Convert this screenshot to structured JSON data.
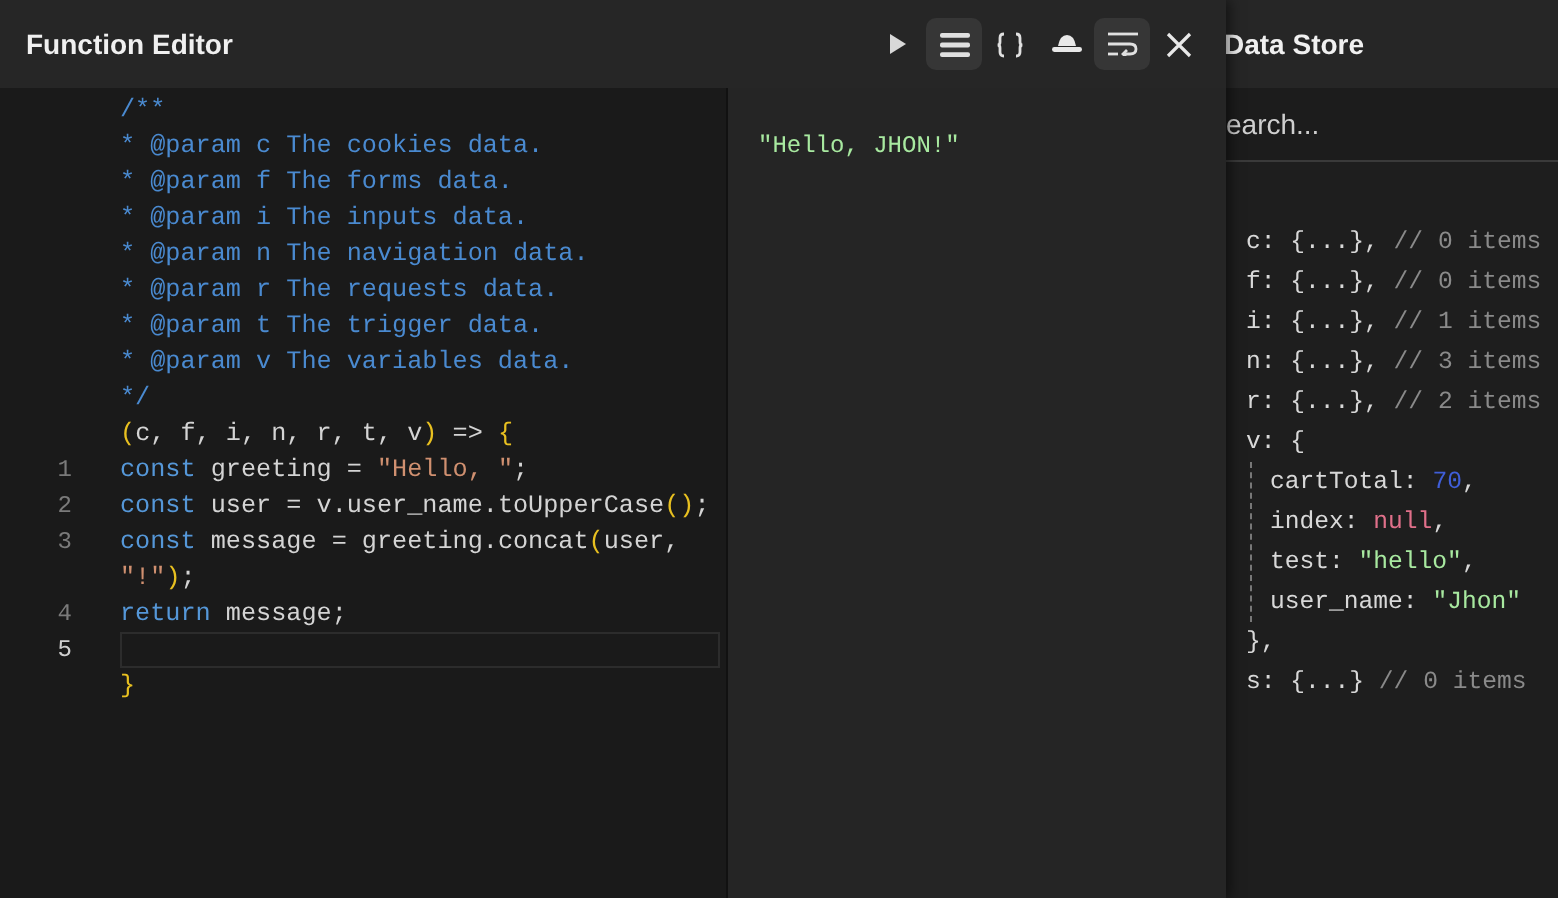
{
  "editor": {
    "title": "Function Editor",
    "toolbar": [
      {
        "kind": "run",
        "selected": false
      },
      {
        "kind": "list",
        "selected": true
      },
      {
        "kind": "braces",
        "selected": false
      },
      {
        "kind": "hat",
        "selected": false
      },
      {
        "kind": "wrap",
        "selected": true
      },
      {
        "kind": "close",
        "selected": false
      }
    ],
    "code_lines": [
      {
        "tokens": [
          {
            "kind": "comment",
            "text": "/**"
          }
        ]
      },
      {
        "tokens": [
          {
            "kind": "comment",
            "text": "* @param c The cookies data."
          }
        ]
      },
      {
        "tokens": [
          {
            "kind": "comment",
            "text": "* @param f The forms data."
          }
        ]
      },
      {
        "tokens": [
          {
            "kind": "comment",
            "text": "* @param i The inputs data."
          }
        ]
      },
      {
        "tokens": [
          {
            "kind": "comment",
            "text": "* @param n The navigation data."
          }
        ]
      },
      {
        "tokens": [
          {
            "kind": "comment",
            "text": "* @param r The requests data."
          }
        ]
      },
      {
        "tokens": [
          {
            "kind": "comment",
            "text": "* @param t The trigger data."
          }
        ]
      },
      {
        "tokens": [
          {
            "kind": "comment",
            "text": "* @param v The variables data."
          }
        ]
      },
      {
        "tokens": [
          {
            "kind": "comment",
            "text": "*/"
          }
        ]
      },
      {
        "tokens": [
          {
            "kind": "bracket",
            "text": "("
          },
          {
            "kind": "plain",
            "text": "c, f, i, n, r, t, v"
          },
          {
            "kind": "bracket",
            "text": ")"
          },
          {
            "kind": "plain",
            "text": " => "
          },
          {
            "kind": "bracket",
            "text": "{"
          }
        ]
      },
      {
        "number": "1",
        "active": false,
        "tokens": [
          {
            "kind": "keyword",
            "text": "const"
          },
          {
            "kind": "plain",
            "text": " greeting = "
          },
          {
            "kind": "string",
            "text": "\"Hello, \""
          },
          {
            "kind": "plain",
            "text": ";"
          }
        ]
      },
      {
        "number": "2",
        "active": false,
        "tokens": [
          {
            "kind": "keyword",
            "text": "const"
          },
          {
            "kind": "plain",
            "text": " user = v.user_name.toUpperCase"
          },
          {
            "kind": "bracket",
            "text": "()"
          },
          {
            "kind": "plain",
            "text": ";"
          }
        ]
      },
      {
        "number": "3",
        "active": false,
        "tokens": [
          {
            "kind": "keyword",
            "text": "const"
          },
          {
            "kind": "plain",
            "text": " message = greeting.concat"
          },
          {
            "kind": "bracket",
            "text": "("
          },
          {
            "kind": "plain",
            "text": "user,"
          }
        ]
      },
      {
        "tokens": [
          {
            "kind": "string",
            "text": "\"!\""
          },
          {
            "kind": "bracket",
            "text": ")"
          },
          {
            "kind": "plain",
            "text": ";"
          }
        ]
      },
      {
        "number": "4",
        "active": false,
        "tokens": [
          {
            "kind": "keyword",
            "text": "return"
          },
          {
            "kind": "plain",
            "text": " message;"
          }
        ]
      },
      {
        "number": "5",
        "active": true
      },
      {
        "tokens": [
          {
            "kind": "bracket",
            "text": "}"
          }
        ]
      }
    ],
    "output": "\"Hello, JHON!\""
  },
  "data_store": {
    "title": "Data Store",
    "search": {
      "placeholder": "earch..."
    },
    "entries": [
      {
        "key": "c:",
        "value": "{...},",
        "comment": "// 0 items"
      },
      {
        "key": "f:",
        "value": "{...},",
        "comment": "// 0 items"
      },
      {
        "key": "i:",
        "value": "{...},",
        "comment": "// 1 items"
      },
      {
        "key": "n:",
        "value": "{...},",
        "comment": "// 3 items"
      },
      {
        "key": "r:",
        "value": "{...},",
        "comment": "// 2 items"
      },
      {
        "key": "v:",
        "value": "{",
        "closing": "},",
        "children": [
          {
            "key": "cartTotal:",
            "value": "70",
            "kind": "number",
            "trail": ","
          },
          {
            "key": "index:",
            "value": "null",
            "kind": "null",
            "trail": ","
          },
          {
            "key": "test:",
            "value": "\"hello\"",
            "kind": "string",
            "trail": ","
          },
          {
            "key": "user_name:",
            "value": "\"Jhon\"",
            "kind": "string"
          }
        ]
      },
      {
        "key": "s:",
        "value": "{...}",
        "comment": "// 0 items"
      }
    ]
  }
}
